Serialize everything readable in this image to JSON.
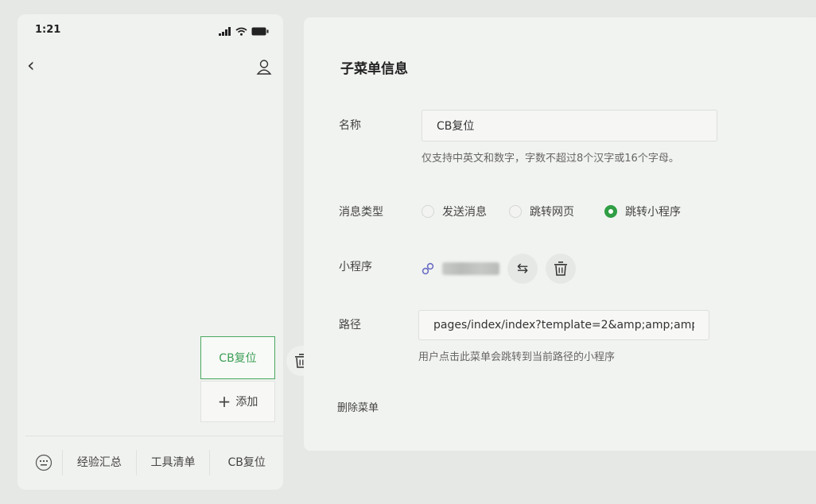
{
  "phone": {
    "status_time": "1:21",
    "back_icon": "chevron-left-icon",
    "user_icon": "user-icon",
    "submenu": {
      "active_label": "CB复位",
      "add_label": "添加"
    },
    "bottom_menu": [
      "经验汇总",
      "工具清单",
      "CB复位"
    ]
  },
  "panel": {
    "title": "子菜单信息",
    "name": {
      "label": "名称",
      "value": "CB复位",
      "hint": "仅支持中英文和数字，字数不超过8个汉字或16个字母。"
    },
    "message_type": {
      "label": "消息类型",
      "options": [
        "发送消息",
        "跳转网页",
        "跳转小程序"
      ],
      "selected_index": 2
    },
    "mini_program": {
      "label": "小程序",
      "name_blurred": true,
      "swap_icon": "swap-icon",
      "delete_icon": "trash-icon"
    },
    "path": {
      "label": "路径",
      "value": "pages/index/index?template=2&amp;amp;amp",
      "hint": "用户点击此菜单会跳转到当前路径的小程序"
    },
    "delete_menu": "删除菜单"
  },
  "colors": {
    "accent_green": "#2f9e44",
    "active_border": "#4aa861"
  }
}
